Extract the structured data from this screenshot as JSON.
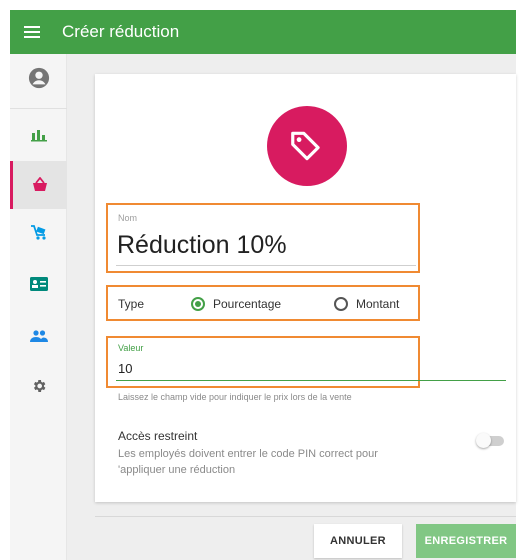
{
  "header": {
    "title": "Créer réduction",
    "menu_icon": "hamburger-menu-icon"
  },
  "sidebar": {
    "items": [
      {
        "icon": "account-circle-icon",
        "active": false
      },
      {
        "icon": "bar-chart-icon",
        "active": false
      },
      {
        "icon": "shopping-basket-icon",
        "active": true
      },
      {
        "icon": "cart-tag-icon",
        "active": false
      },
      {
        "icon": "id-card-icon",
        "active": false
      },
      {
        "icon": "people-icon",
        "active": false
      },
      {
        "icon": "settings-gear-icon",
        "active": false
      }
    ]
  },
  "form": {
    "name_label": "Nom",
    "name_value": "Réduction 10%",
    "type_label": "Type",
    "type_options": [
      {
        "label": "Pourcentage",
        "selected": true
      },
      {
        "label": "Montant",
        "selected": false
      }
    ],
    "value_label": "Valeur",
    "value_value": "10",
    "value_helper": "Laissez le champ vide pour indiquer le prix lors de la vente",
    "restricted_title": "Accès restreint",
    "restricted_desc": "Les employés doivent entrer le code PIN correct pour 'appliquer une réduction",
    "restricted_enabled": false
  },
  "actions": {
    "cancel_label": "ANNULER",
    "save_label": "ENREGISTRER"
  },
  "colors": {
    "primary_green": "#43a047",
    "accent_pink": "#d81b60",
    "highlight_orange": "#f08a32",
    "save_disabled_green": "#81c784"
  }
}
